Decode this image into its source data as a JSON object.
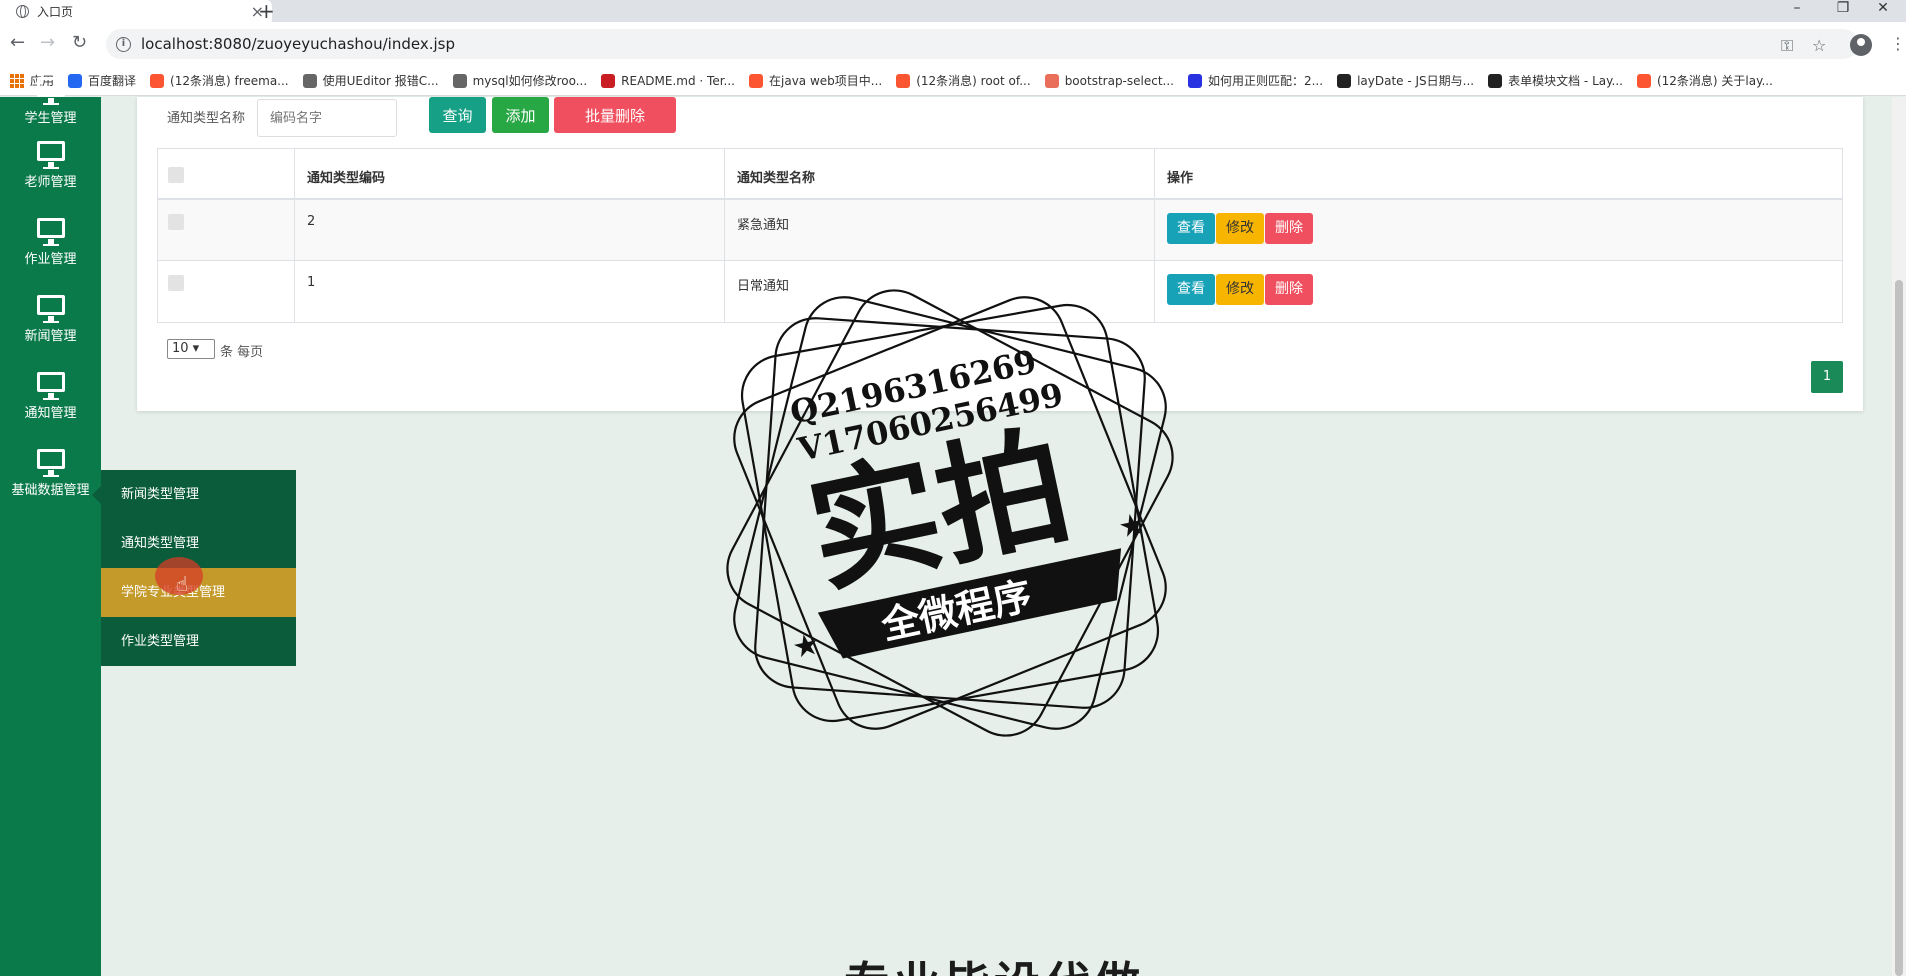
{
  "browser": {
    "tab_title": "入口页",
    "url": "localhost:8080/zuoyeyuchashou/index.jsp",
    "bookmarks": [
      {
        "label": "应用",
        "icon": "apps-icon",
        "color": "#e8710a"
      },
      {
        "label": "百度翻译",
        "icon": "baidu-translate-icon",
        "color": "#2468f2"
      },
      {
        "label": "(12条消息) freema...",
        "icon": "csdn-icon",
        "color": "#fc5531"
      },
      {
        "label": "使用UEditor 报错C...",
        "icon": "link-icon",
        "color": "#666666"
      },
      {
        "label": "mysql如何修改roo...",
        "icon": "link-icon",
        "color": "#666666"
      },
      {
        "label": "README.md · Ter...",
        "icon": "gitee-icon",
        "color": "#c71d23"
      },
      {
        "label": "在java web项目中...",
        "icon": "csdn-icon",
        "color": "#fc5531"
      },
      {
        "label": "(12条消息) root of...",
        "icon": "csdn-icon",
        "color": "#fc5531"
      },
      {
        "label": "bootstrap-select...",
        "icon": "jianshu-icon",
        "color": "#ea6f5a"
      },
      {
        "label": "如何用正则匹配：2...",
        "icon": "baidu-icon",
        "color": "#2932e1"
      },
      {
        "label": "layDate - JS日期与...",
        "icon": "layui-icon",
        "color": "#222222"
      },
      {
        "label": "表单模块文档 - Lay...",
        "icon": "layui-icon",
        "color": "#222222"
      },
      {
        "label": "(12条消息) 关于lay...",
        "icon": "csdn-icon",
        "color": "#fc5531"
      }
    ]
  },
  "sidebar": {
    "items": [
      {
        "label": "学生管理",
        "icon": "monitor-icon"
      },
      {
        "label": "老师管理",
        "icon": "monitor-icon"
      },
      {
        "label": "作业管理",
        "icon": "monitor-icon"
      },
      {
        "label": "新闻管理",
        "icon": "monitor-icon"
      },
      {
        "label": "通知管理",
        "icon": "monitor-icon"
      },
      {
        "label": "基础数据管理",
        "icon": "monitor-icon"
      }
    ],
    "submenu": [
      {
        "label": "新闻类型管理"
      },
      {
        "label": "通知类型管理"
      },
      {
        "label": "学院专业类型管理",
        "active": true
      },
      {
        "label": "作业类型管理"
      }
    ]
  },
  "search": {
    "label": "通知类型名称",
    "placeholder": "编码名字",
    "query_label": "查询",
    "add_label": "添加",
    "batch_delete_label": "批量删除"
  },
  "table": {
    "columns": [
      "通知类型编码",
      "通知类型名称",
      "操作"
    ],
    "rows": [
      {
        "code": "2",
        "name": "紧急通知"
      },
      {
        "code": "1",
        "name": "日常通知"
      }
    ],
    "actions": {
      "view": "查看",
      "edit": "修改",
      "delete": "删除"
    }
  },
  "pager": {
    "page_size": "10",
    "per_page_label": "条 每页",
    "current_page": "1"
  },
  "watermark": {
    "line1": "Q2196316269",
    "line2": "V17060256499",
    "main": "实拍",
    "ribbon": "全微程序"
  },
  "bottom_text": "专业毕设代做",
  "colors": {
    "sidebar": "#0b7a4b",
    "submenu": "#0a5c3b",
    "submenu_active": "#c49a2a",
    "query": "#16a085",
    "add": "#28a745",
    "danger": "#ef4f5e",
    "view": "#17a2b8",
    "edit": "#f7b500"
  }
}
